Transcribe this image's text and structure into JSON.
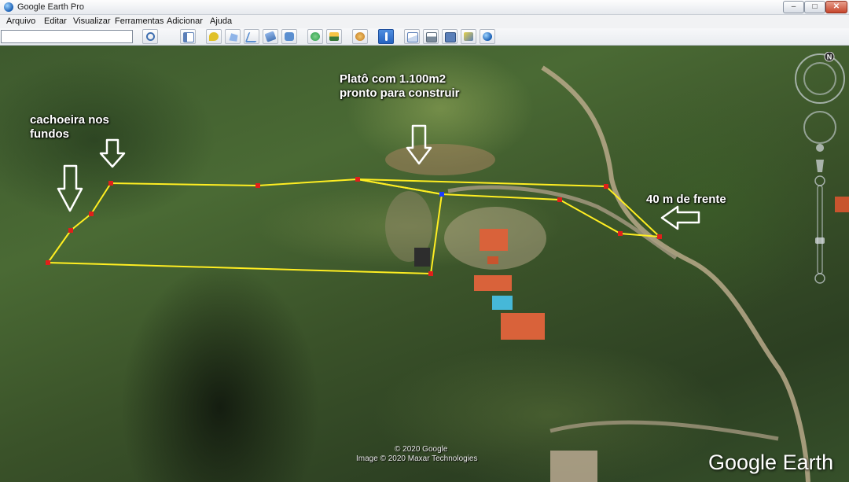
{
  "window": {
    "title": "Google Earth Pro",
    "minimize": "–",
    "maximize": "□",
    "close": "✕"
  },
  "menu": {
    "items": [
      "Arquivo",
      "Editar",
      "Visualizar",
      "Ferramentas",
      "Adicionar",
      "Ajuda"
    ]
  },
  "toolbar": {
    "search": {
      "value": "",
      "placeholder": ""
    },
    "buttons": [
      {
        "icon": "search-icon",
        "color": "#3f6fb0"
      },
      {
        "icon": "sidebar-toggle-icon",
        "color": "#5b7fb8"
      },
      {
        "icon": "placemark-icon",
        "color": "#e0c12a"
      },
      {
        "icon": "polygon-icon",
        "color": "#5b8fd0"
      },
      {
        "icon": "path-icon",
        "color": "#5b8fd0"
      },
      {
        "icon": "image-overlay-icon",
        "color": "#5b8fd0"
      },
      {
        "icon": "record-tour-icon",
        "color": "#5b8fd0"
      },
      {
        "icon": "historical-imagery-icon",
        "color": "#2a9d4a"
      },
      {
        "icon": "sunlight-icon",
        "color": "#e8a020"
      },
      {
        "icon": "planets-icon",
        "color": "#d09030"
      },
      {
        "icon": "ruler-icon",
        "color": "#2f6fc8"
      },
      {
        "icon": "email-icon",
        "color": "#5b7fb8"
      },
      {
        "icon": "print-icon",
        "color": "#7a8a9a"
      },
      {
        "icon": "save-image-icon",
        "color": "#5b7fb8"
      },
      {
        "icon": "view-in-maps-icon",
        "color": "#5b7fb8"
      },
      {
        "icon": "earth-gallery-icon",
        "color": "#2f6fc8"
      }
    ]
  },
  "map": {
    "annotations": {
      "plato": "Platô com 1.100m2\npronto para construir",
      "cachoeira": "cachoeira nos\nfundos",
      "frente": "40 m de frente"
    },
    "credits": {
      "google": "© 2020 Google",
      "imagery": "Image © 2020 Maxar Technologies"
    },
    "logo": "Google Earth",
    "compass_north": "N",
    "colors": {
      "boundary": "#ffee22",
      "vertex": "#e0201a",
      "selected_vertex": "#1b3cff"
    }
  }
}
